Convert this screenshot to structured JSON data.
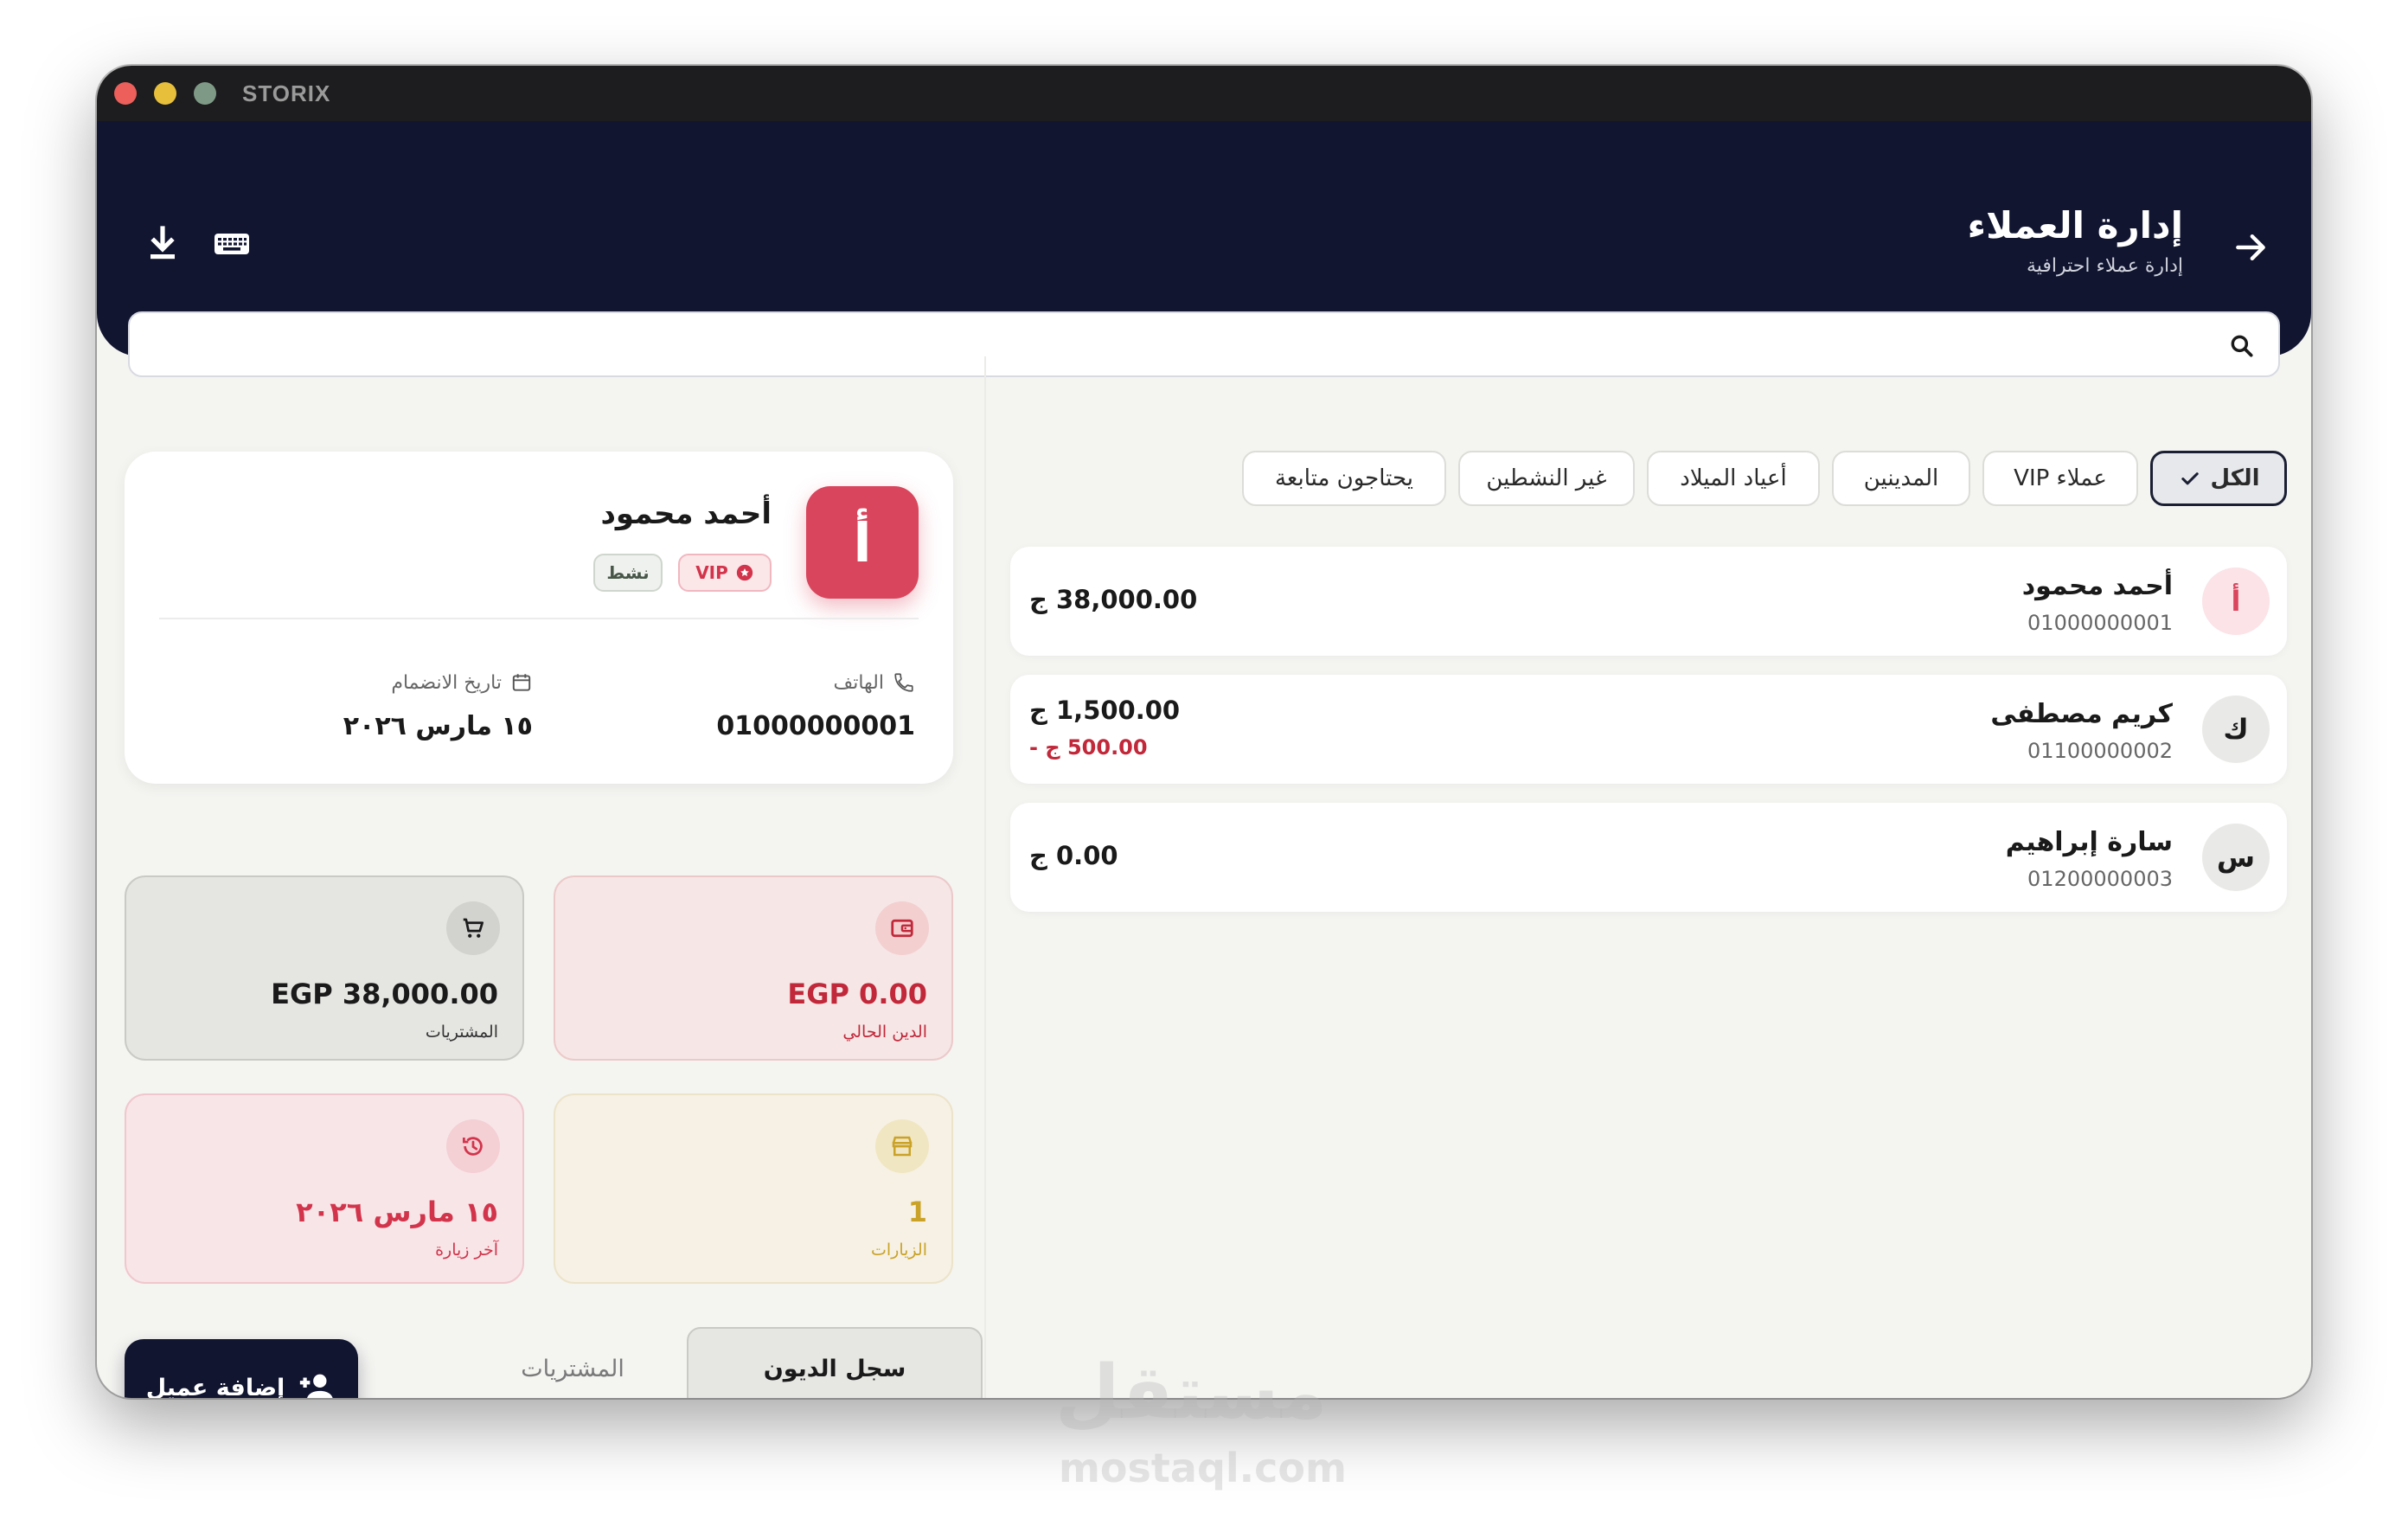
{
  "window": {
    "app_name": "STORIX"
  },
  "header": {
    "title": "إدارة العملاء",
    "subtitle": "إدارة عملاء احترافية",
    "icons": [
      "arrow-right-icon",
      "download-icon",
      "keyboard-icon"
    ]
  },
  "search": {
    "value": "",
    "placeholder": ""
  },
  "profile": {
    "avatar_letter": "أ",
    "name": "أحمد محمود",
    "badge_vip": "VIP",
    "badge_status": "نشط",
    "phone_label": "الهاتف",
    "phone_value": "01000000001",
    "join_label": "تاريخ الانضمام",
    "join_value": "١٥ مارس ٢٠٢٦"
  },
  "stats": {
    "purchases": {
      "value": "EGP 38,000.00",
      "label": "المشتريات"
    },
    "debt": {
      "value": "EGP 0.00",
      "label": "الدين الحالي"
    },
    "last_visit": {
      "value": "١٥ مارس ٢٠٢٦",
      "label": "آخر زيارة"
    },
    "visits": {
      "value": "1",
      "label": "الزيارات"
    }
  },
  "bottom_tabs": {
    "debts": "سجل الديون",
    "purchases": "المشتريات"
  },
  "add_button": "إضافة عميل",
  "filters": {
    "all": "الكل",
    "vip": "عملاء VIP",
    "debtors": "المدينين",
    "birthdays": "أعياد الميلاد",
    "inactive": "غير النشطين",
    "followup": "يحتاجون متابعة"
  },
  "customers": [
    {
      "letter": "أ",
      "name": "أحمد محمود",
      "phone": "01000000001",
      "amount": "38,000.00 ج",
      "debt": ""
    },
    {
      "letter": "ك",
      "name": "كريم مصطفى",
      "phone": "01100000002",
      "amount": "1,500.00 ج",
      "debt": "500.00 ج -"
    },
    {
      "letter": "س",
      "name": "سارة إبراهيم",
      "phone": "01200000003",
      "amount": "0.00 ج",
      "debt": ""
    }
  ],
  "watermark": {
    "ar": "مستقل",
    "en": "mostaql.com"
  },
  "colors": {
    "navy": "#111530",
    "accent_red": "#d9455c",
    "debt_red": "#c1283a",
    "visits_gold": "#c9a227"
  }
}
